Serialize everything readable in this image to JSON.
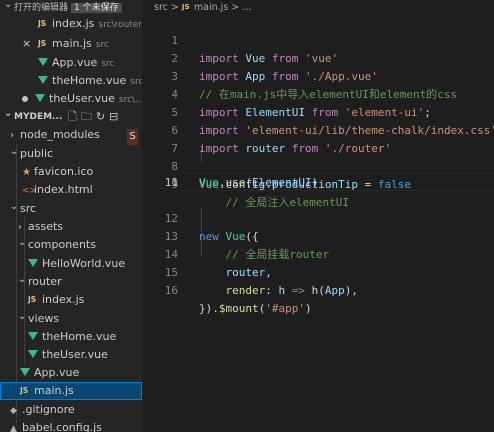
{
  "open_editors": {
    "header": "打开的编辑器",
    "unsaved_badge": "1 个未保存",
    "items": [
      {
        "name": "index.js",
        "desc": "src\\router",
        "icon": "js"
      },
      {
        "name": "main.js",
        "desc": "src",
        "icon": "js",
        "close": "×"
      },
      {
        "name": "App.vue",
        "desc": "src",
        "icon": "vue"
      },
      {
        "name": "theHome.vue",
        "desc": "src...",
        "icon": "vue"
      },
      {
        "name": "theUser.vue",
        "desc": "src\\...",
        "icon": "vue",
        "dirty": true
      }
    ]
  },
  "project": {
    "header": "MYDEM...",
    "hover_badge": "S"
  },
  "tree": [
    {
      "name": "node_modules",
      "type": "folder",
      "state": "collapsed"
    },
    {
      "name": "public",
      "type": "folder",
      "state": "expanded"
    },
    {
      "name": "favicon.ico",
      "type": "ico"
    },
    {
      "name": "index.html",
      "type": "html"
    },
    {
      "name": "src",
      "type": "folder",
      "state": "expanded"
    },
    {
      "name": "assets",
      "type": "folder",
      "state": "collapsed"
    },
    {
      "name": "components",
      "type": "folder",
      "state": "expanded"
    },
    {
      "name": "HelloWorld.vue",
      "type": "vue"
    },
    {
      "name": "router",
      "type": "folder",
      "state": "expanded"
    },
    {
      "name": "index.js",
      "type": "js"
    },
    {
      "name": "views",
      "type": "folder",
      "state": "expanded"
    },
    {
      "name": "theHome.vue",
      "type": "vue"
    },
    {
      "name": "theUser.vue",
      "type": "vue"
    },
    {
      "name": "App.vue",
      "type": "vue"
    },
    {
      "name": "main.js",
      "type": "js",
      "selected": true
    },
    {
      "name": ".gitignore",
      "type": "git"
    },
    {
      "name": "babel.config.js",
      "type": "js"
    }
  ],
  "breadcrumb": {
    "folder": "src",
    "sep": ">",
    "file": "main.js",
    "rest": "..."
  },
  "editor": {
    "active_line": 11,
    "lines": [
      {
        "n": "1",
        "t": "import Vue from 'vue'"
      },
      {
        "n": "2",
        "t": "import App from './App.vue'"
      },
      {
        "n": "3",
        "t": "// 在main.js中导入elementUI和element的css"
      },
      {
        "n": "4",
        "t": "import ElementUI from 'element-ui';"
      },
      {
        "n": "5",
        "t": "import 'element-ui/lib/theme-chalk/index.css';"
      },
      {
        "n": "6",
        "t": "import router from './router'"
      },
      {
        "n": "7",
        "t": ""
      },
      {
        "n": "8",
        "t": "Vue.config.productionTip = false"
      },
      {
        "n": "9",
        "t": "    // 全局注入elementUI"
      },
      {
        "n": "10",
        "t": "Vue.use(ElementUI)"
      },
      {
        "n": "11",
        "t": ""
      },
      {
        "n": "12",
        "t": "new Vue({"
      },
      {
        "n": "13",
        "t": "    // 全局挂载router"
      },
      {
        "n": "14",
        "t": "    router,"
      },
      {
        "n": "15",
        "t": "    render: h => h(App),"
      },
      {
        "n": "16",
        "t": "}).$mount('#app')"
      }
    ]
  },
  "colors": {
    "keyword": "#c586c0",
    "storage": "#569cd6",
    "variable": "#9cdcfe",
    "class": "#4ec9b0",
    "string": "#ce9178",
    "comment": "#6a9955",
    "function": "#dcdcaa",
    "vue_icon": "#41b883",
    "js_icon": "#e5c07b",
    "selection": "#094771"
  }
}
